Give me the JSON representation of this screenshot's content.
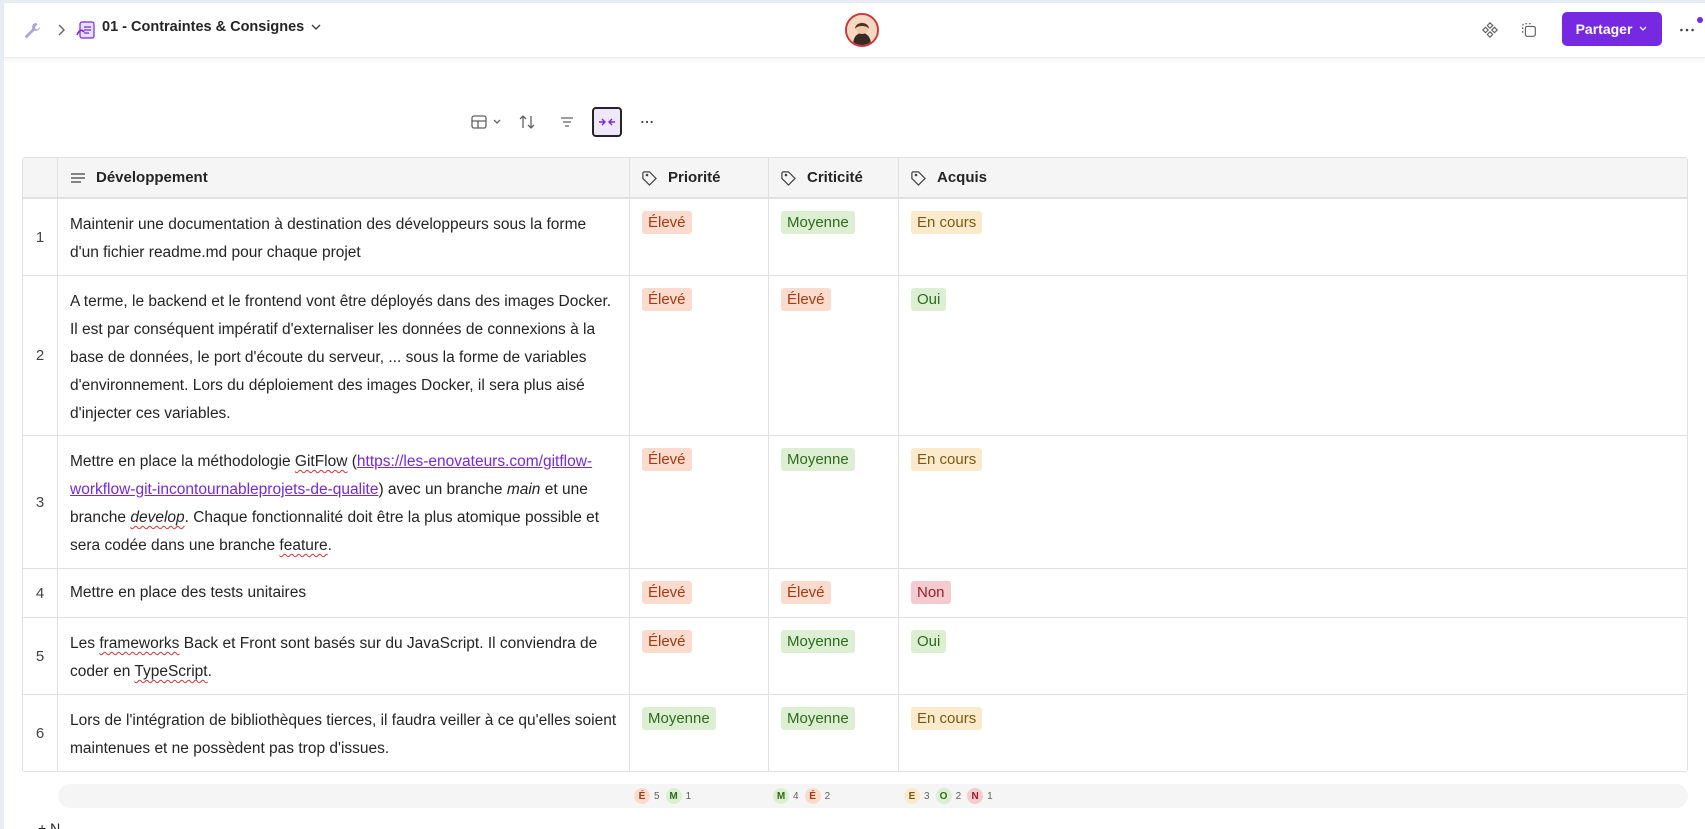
{
  "header": {
    "title": "01 - Contraintes & Consignes",
    "share_label": "Partager"
  },
  "columns": {
    "development": "Développement",
    "priority": "Priorité",
    "criticality": "Criticité",
    "acquired": "Acquis"
  },
  "rows": [
    {
      "index": "1",
      "text_a": "Maintenir une documentation à destination des développeurs sous la forme d'un fichier readme.md pour chaque projet",
      "priority": "Élevé",
      "criticality": "Moyenne",
      "acquired": "En cours"
    },
    {
      "index": "2",
      "text_a": "A terme, le backend et le frontend vont être déployés dans des images Docker. Il est par conséquent impératif d'externaliser les données de connexions à la base de données, le port d'écoute du serveur, ... sous la forme de variables d'environnement. Lors du déploiement des images Docker, il sera plus aisé d'injecter ces variables.",
      "priority": "Élevé",
      "criticality": "Élevé",
      "acquired": "Oui"
    },
    {
      "index": "3",
      "text_a": "Mettre en place la méthodologie ",
      "text_gitflow": "GitFlow",
      "text_b": " (",
      "link": "https://les-enovateurs.com/gitflow-workflow-git-incontournableprojets-de-qualite",
      "text_c": ") avec un branche ",
      "text_main": "main",
      "text_d": " et une branche ",
      "text_develop": "develop",
      "text_e": ". Chaque fonctionnalité doit être la plus atomique possible et sera codée dans une branche ",
      "text_feature": "feature",
      "text_f": ".",
      "priority": "Élevé",
      "criticality": "Moyenne",
      "acquired": "En cours"
    },
    {
      "index": "4",
      "text_a": "Mettre en place des tests unitaires",
      "priority": "Élevé",
      "criticality": "Élevé",
      "acquired": "Non"
    },
    {
      "index": "5",
      "text_a": "Les ",
      "text_frameworks": "frameworks",
      "text_b": " Back et Front sont basés sur du JavaScript. Il conviendra de coder en ",
      "text_ts": "TypeScript",
      "text_c": ".",
      "priority": "Élevé",
      "criticality": "Moyenne",
      "acquired": "Oui"
    },
    {
      "index": "6",
      "text_a": "Lors de l'intégration de bibliothèques tierces, il faudra veiller à ce qu'elles soient maintenues et ne possèdent pas trop d'issues.",
      "priority": "Moyenne",
      "criticality": "Moyenne",
      "acquired": "En cours"
    }
  ],
  "summary": {
    "priority": [
      {
        "letter": "É",
        "count": "5",
        "color": "#fadbcd",
        "fg": "#a33a11"
      },
      {
        "letter": "M",
        "count": "1",
        "color": "#dcefd2",
        "fg": "#2e6b1c"
      }
    ],
    "criticality": [
      {
        "letter": "M",
        "count": "4",
        "color": "#dcefd2",
        "fg": "#2e6b1c"
      },
      {
        "letter": "É",
        "count": "2",
        "color": "#fadbcd",
        "fg": "#a33a11"
      }
    ],
    "acquired": [
      {
        "letter": "E",
        "count": "3",
        "color": "#fbeacb",
        "fg": "#7a5a12"
      },
      {
        "letter": "O",
        "count": "2",
        "color": "#dcefd2",
        "fg": "#2e6b1c"
      },
      {
        "letter": "N",
        "count": "1",
        "color": "#f6cbd0",
        "fg": "#9b1e2a"
      }
    ]
  },
  "add_row_label": "+     N",
  "colors": {
    "accent": "#7629e0",
    "tag_high": "#fadbcd",
    "tag_medium": "#dcefd2",
    "tag_in_progress": "#fbeacb",
    "tag_yes": "#dcefd2",
    "tag_no": "#f6cbd0"
  },
  "icons": {
    "breadcrumb_root": "wrench-icon",
    "page": "page-icon",
    "apps": "apps-icon",
    "copy": "copy-icon",
    "more": "more-icon"
  }
}
